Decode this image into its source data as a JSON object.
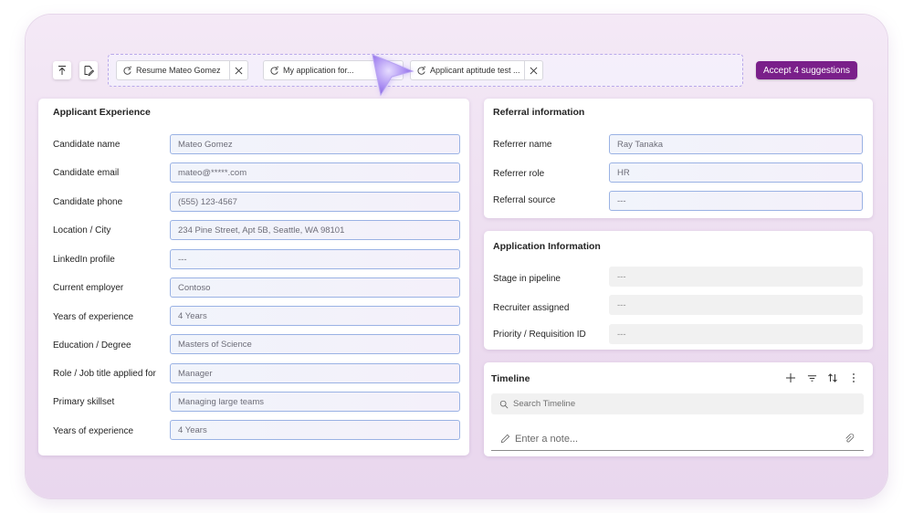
{
  "toolbar": {
    "upload_icon": "upload-icon",
    "edit_icon": "edit-document-icon"
  },
  "suggestions": {
    "chips": [
      {
        "label": "Resume Mateo Gomez",
        "icon": "refresh-spark-icon"
      },
      {
        "label": "My application for...",
        "icon": "refresh-spark-icon"
      },
      {
        "label": "Applicant aptitude test ...",
        "icon": "refresh-spark-icon"
      }
    ],
    "accept_label": "Accept 4 suggestions",
    "accent_color": "#7a1f8a"
  },
  "applicant": {
    "title": "Applicant Experience",
    "rows": [
      {
        "label": "Candidate name",
        "value": "Mateo Gomez"
      },
      {
        "label": "Candidate email",
        "value": "mateo@*****.com"
      },
      {
        "label": "Candidate phone",
        "value": "(555) 123-4567"
      },
      {
        "label": "Location / City",
        "value": "234 Pine Street, Apt 5B, Seattle, WA 98101"
      },
      {
        "label": "LinkedIn profile",
        "value": "---"
      },
      {
        "label": "Current employer",
        "value": "Contoso"
      },
      {
        "label": "Years of experience",
        "value": "4 Years"
      },
      {
        "label": "Education / Degree",
        "value": "Masters of Science"
      },
      {
        "label": "Role / Job title applied for",
        "value": "Manager"
      },
      {
        "label": "Primary skillset",
        "value": "Managing large teams"
      },
      {
        "label": "Years of experience",
        "value": "4 Years"
      }
    ]
  },
  "referral": {
    "title": "Referral information",
    "rows": [
      {
        "label": "Referrer name",
        "value": "Ray Tanaka"
      },
      {
        "label": "Referrer role",
        "value": "HR"
      },
      {
        "label": "Referral source",
        "value": "---"
      }
    ]
  },
  "application": {
    "title": "Application Information",
    "rows": [
      {
        "label": "Stage in pipeline",
        "value": "---"
      },
      {
        "label": "Recruiter assigned",
        "value": "---"
      },
      {
        "label": "Priority / Requisition ID",
        "value": "---"
      }
    ]
  },
  "timeline": {
    "title": "Timeline",
    "search_placeholder": "Search Timeline",
    "note_placeholder": "Enter a note..."
  }
}
